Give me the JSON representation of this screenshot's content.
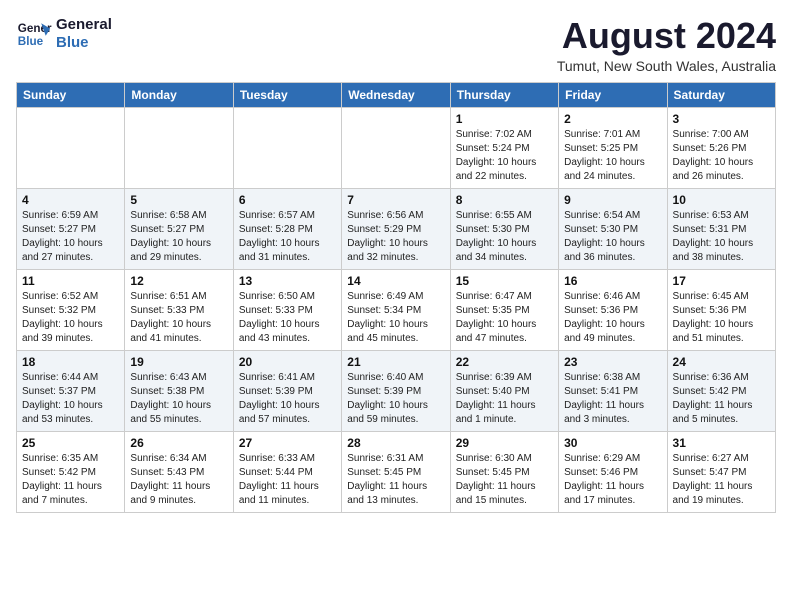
{
  "logo": {
    "line1": "General",
    "line2": "Blue"
  },
  "title": {
    "month_year": "August 2024",
    "location": "Tumut, New South Wales, Australia"
  },
  "days_of_week": [
    "Sunday",
    "Monday",
    "Tuesday",
    "Wednesday",
    "Thursday",
    "Friday",
    "Saturday"
  ],
  "weeks": [
    [
      {
        "day": "",
        "info": ""
      },
      {
        "day": "",
        "info": ""
      },
      {
        "day": "",
        "info": ""
      },
      {
        "day": "",
        "info": ""
      },
      {
        "day": "1",
        "info": "Sunrise: 7:02 AM\nSunset: 5:24 PM\nDaylight: 10 hours\nand 22 minutes."
      },
      {
        "day": "2",
        "info": "Sunrise: 7:01 AM\nSunset: 5:25 PM\nDaylight: 10 hours\nand 24 minutes."
      },
      {
        "day": "3",
        "info": "Sunrise: 7:00 AM\nSunset: 5:26 PM\nDaylight: 10 hours\nand 26 minutes."
      }
    ],
    [
      {
        "day": "4",
        "info": "Sunrise: 6:59 AM\nSunset: 5:27 PM\nDaylight: 10 hours\nand 27 minutes."
      },
      {
        "day": "5",
        "info": "Sunrise: 6:58 AM\nSunset: 5:27 PM\nDaylight: 10 hours\nand 29 minutes."
      },
      {
        "day": "6",
        "info": "Sunrise: 6:57 AM\nSunset: 5:28 PM\nDaylight: 10 hours\nand 31 minutes."
      },
      {
        "day": "7",
        "info": "Sunrise: 6:56 AM\nSunset: 5:29 PM\nDaylight: 10 hours\nand 32 minutes."
      },
      {
        "day": "8",
        "info": "Sunrise: 6:55 AM\nSunset: 5:30 PM\nDaylight: 10 hours\nand 34 minutes."
      },
      {
        "day": "9",
        "info": "Sunrise: 6:54 AM\nSunset: 5:30 PM\nDaylight: 10 hours\nand 36 minutes."
      },
      {
        "day": "10",
        "info": "Sunrise: 6:53 AM\nSunset: 5:31 PM\nDaylight: 10 hours\nand 38 minutes."
      }
    ],
    [
      {
        "day": "11",
        "info": "Sunrise: 6:52 AM\nSunset: 5:32 PM\nDaylight: 10 hours\nand 39 minutes."
      },
      {
        "day": "12",
        "info": "Sunrise: 6:51 AM\nSunset: 5:33 PM\nDaylight: 10 hours\nand 41 minutes."
      },
      {
        "day": "13",
        "info": "Sunrise: 6:50 AM\nSunset: 5:33 PM\nDaylight: 10 hours\nand 43 minutes."
      },
      {
        "day": "14",
        "info": "Sunrise: 6:49 AM\nSunset: 5:34 PM\nDaylight: 10 hours\nand 45 minutes."
      },
      {
        "day": "15",
        "info": "Sunrise: 6:47 AM\nSunset: 5:35 PM\nDaylight: 10 hours\nand 47 minutes."
      },
      {
        "day": "16",
        "info": "Sunrise: 6:46 AM\nSunset: 5:36 PM\nDaylight: 10 hours\nand 49 minutes."
      },
      {
        "day": "17",
        "info": "Sunrise: 6:45 AM\nSunset: 5:36 PM\nDaylight: 10 hours\nand 51 minutes."
      }
    ],
    [
      {
        "day": "18",
        "info": "Sunrise: 6:44 AM\nSunset: 5:37 PM\nDaylight: 10 hours\nand 53 minutes."
      },
      {
        "day": "19",
        "info": "Sunrise: 6:43 AM\nSunset: 5:38 PM\nDaylight: 10 hours\nand 55 minutes."
      },
      {
        "day": "20",
        "info": "Sunrise: 6:41 AM\nSunset: 5:39 PM\nDaylight: 10 hours\nand 57 minutes."
      },
      {
        "day": "21",
        "info": "Sunrise: 6:40 AM\nSunset: 5:39 PM\nDaylight: 10 hours\nand 59 minutes."
      },
      {
        "day": "22",
        "info": "Sunrise: 6:39 AM\nSunset: 5:40 PM\nDaylight: 11 hours\nand 1 minute."
      },
      {
        "day": "23",
        "info": "Sunrise: 6:38 AM\nSunset: 5:41 PM\nDaylight: 11 hours\nand 3 minutes."
      },
      {
        "day": "24",
        "info": "Sunrise: 6:36 AM\nSunset: 5:42 PM\nDaylight: 11 hours\nand 5 minutes."
      }
    ],
    [
      {
        "day": "25",
        "info": "Sunrise: 6:35 AM\nSunset: 5:42 PM\nDaylight: 11 hours\nand 7 minutes."
      },
      {
        "day": "26",
        "info": "Sunrise: 6:34 AM\nSunset: 5:43 PM\nDaylight: 11 hours\nand 9 minutes."
      },
      {
        "day": "27",
        "info": "Sunrise: 6:33 AM\nSunset: 5:44 PM\nDaylight: 11 hours\nand 11 minutes."
      },
      {
        "day": "28",
        "info": "Sunrise: 6:31 AM\nSunset: 5:45 PM\nDaylight: 11 hours\nand 13 minutes."
      },
      {
        "day": "29",
        "info": "Sunrise: 6:30 AM\nSunset: 5:45 PM\nDaylight: 11 hours\nand 15 minutes."
      },
      {
        "day": "30",
        "info": "Sunrise: 6:29 AM\nSunset: 5:46 PM\nDaylight: 11 hours\nand 17 minutes."
      },
      {
        "day": "31",
        "info": "Sunrise: 6:27 AM\nSunset: 5:47 PM\nDaylight: 11 hours\nand 19 minutes."
      }
    ]
  ]
}
